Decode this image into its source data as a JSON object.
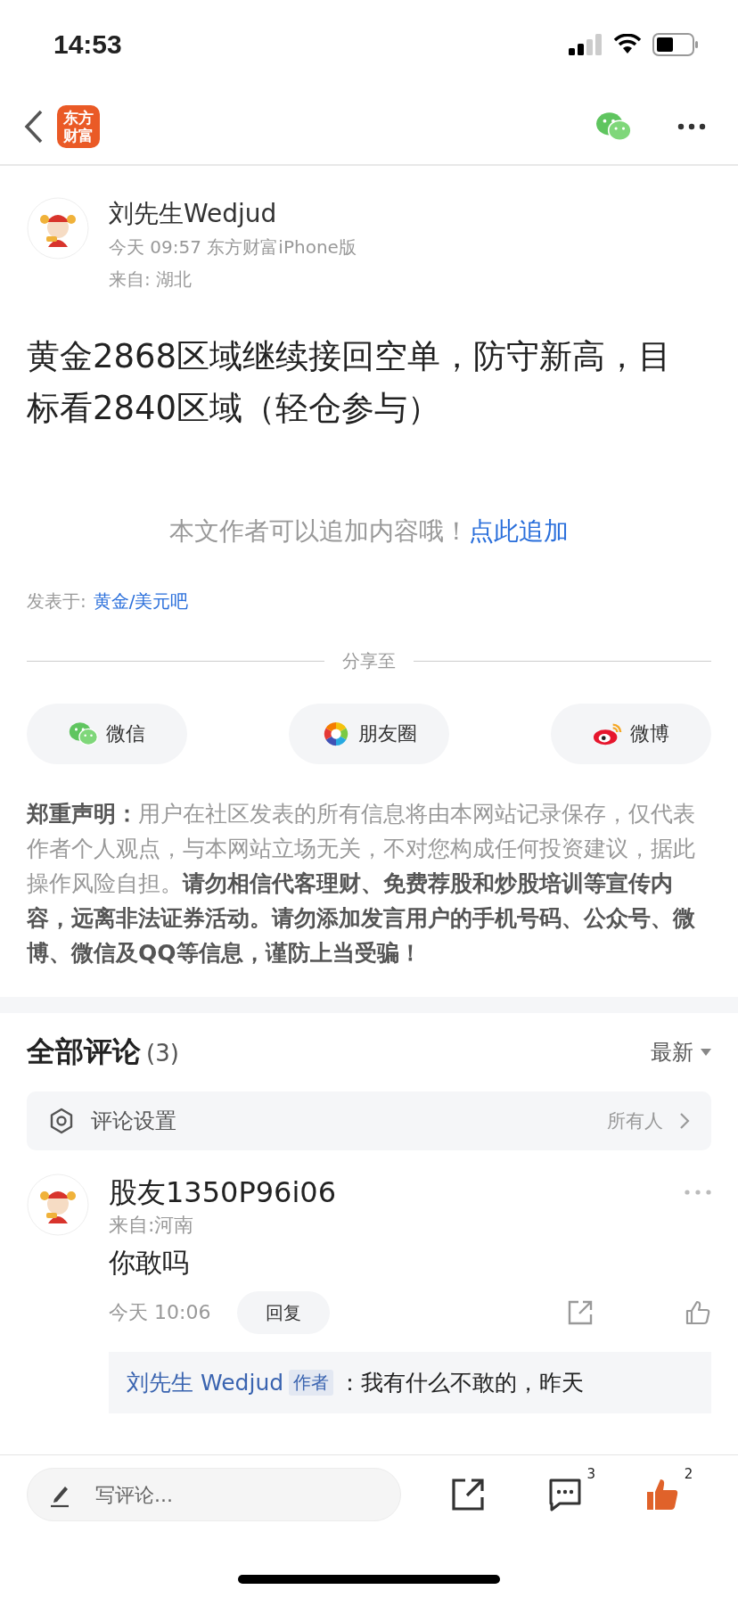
{
  "status_bar": {
    "time": "14:53"
  },
  "nav": {
    "logo_lines": [
      "东方",
      "财富"
    ]
  },
  "post": {
    "author": "刘先生Wedjud",
    "meta": "今天 09:57 东方财富iPhone版",
    "location": "来自: 湖北",
    "title": "黄金2868区域继续接回空单，防守新高，目标看2840区域（轻仓参与）",
    "append_hint": "本文作者可以追加内容哦！",
    "append_link": "点此追加",
    "posted_in_label": "发表于:",
    "posted_in_link": "黄金/美元吧"
  },
  "share": {
    "label": "分享至",
    "targets": [
      {
        "kind": "wechat",
        "label": "微信"
      },
      {
        "kind": "moments",
        "label": "朋友圈"
      },
      {
        "kind": "weibo",
        "label": "微博"
      }
    ]
  },
  "disclaimer": "**郑重声明：**用户在社区发表的所有信息将由本网站记录保存，仅代表作者个人观点，与本网站立场无关，不对您构成任何投资建议，据此操作风险自担。**请勿相信代客理财、免费荐股和炒股培训等宣传内容，远离非法证券活动。请勿添加发言用户的手机号码、公众号、微博、微信及QQ等信息，谨防上当受骗！**",
  "comments": {
    "title": "全部评论",
    "count": "(3)",
    "sort": "最新",
    "settings": {
      "label": "评论设置",
      "value": "所有人"
    },
    "items": [
      {
        "user": "股友1350P96i06",
        "location": "来自:河南",
        "text": "你敢吗",
        "time": "今天 10:06",
        "reply_button": "回复",
        "replies": [
          {
            "user": "刘先生 Wedjud",
            "badge": "作者",
            "text": "：我有什么不敢的，昨天"
          }
        ]
      }
    ]
  },
  "bottom_bar": {
    "placeholder": "写评论...",
    "comment_count": "3",
    "like_count": "2",
    "liked": true
  }
}
